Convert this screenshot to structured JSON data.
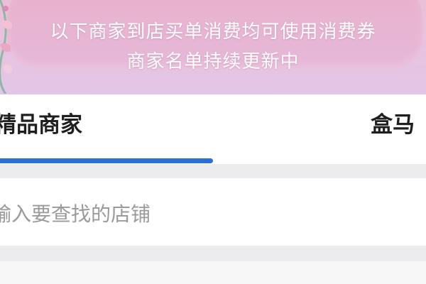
{
  "banner": {
    "line1": "以下商家到店买单消费均可使用消费券",
    "line2": "商家名单持续更新中",
    "accent_color": "#e8b1cc"
  },
  "tabs": {
    "items": [
      {
        "label": "精品商家"
      },
      {
        "label": "盒马"
      }
    ],
    "active_indicator_color": "#2b6fd6"
  },
  "search": {
    "placeholder": "输入要查找的店铺"
  }
}
